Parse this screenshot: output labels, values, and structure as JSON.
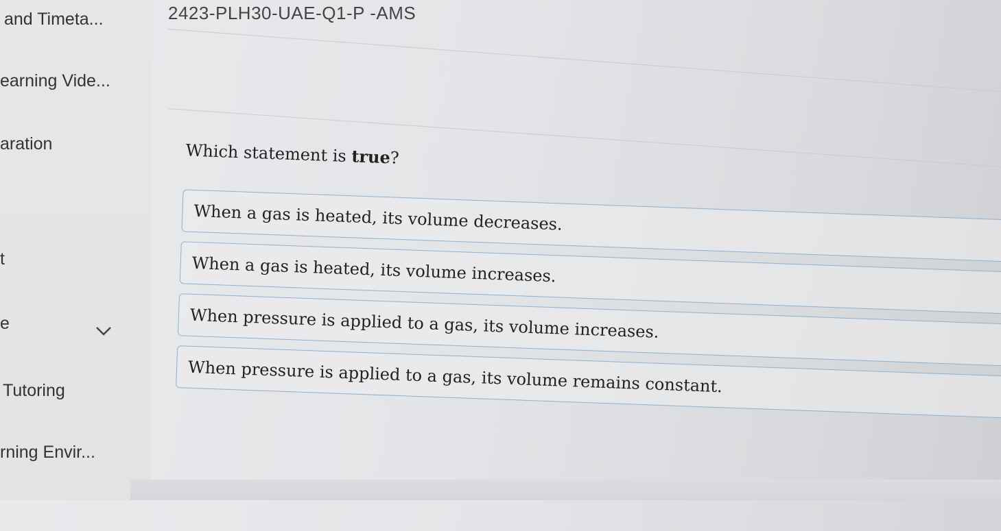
{
  "header": {
    "title": "2423-PLH30-UAE-Q1-P -AMS"
  },
  "sidebar": {
    "items": [
      {
        "label": "and Timeta..."
      },
      {
        "label": "earning Vide..."
      },
      {
        "label": "aration"
      },
      {
        "label": "t"
      },
      {
        "label": "e"
      },
      {
        "label": "Tutoring"
      },
      {
        "label": "rning Envir..."
      }
    ],
    "expand_icon": "chevron-down-icon"
  },
  "question": {
    "prefix": "Which statement is ",
    "emphasis": "true",
    "suffix": "?"
  },
  "options": [
    {
      "label": "When a gas is heated, its volume decreases."
    },
    {
      "label": "When a gas is heated, its volume increases."
    },
    {
      "label": "When pressure is applied to a gas, its volume increases."
    },
    {
      "label": "When pressure is applied to a gas, its volume remains constant."
    }
  ],
  "colors": {
    "option_border": "#8fb0cf",
    "background": "#e6e7e9"
  }
}
